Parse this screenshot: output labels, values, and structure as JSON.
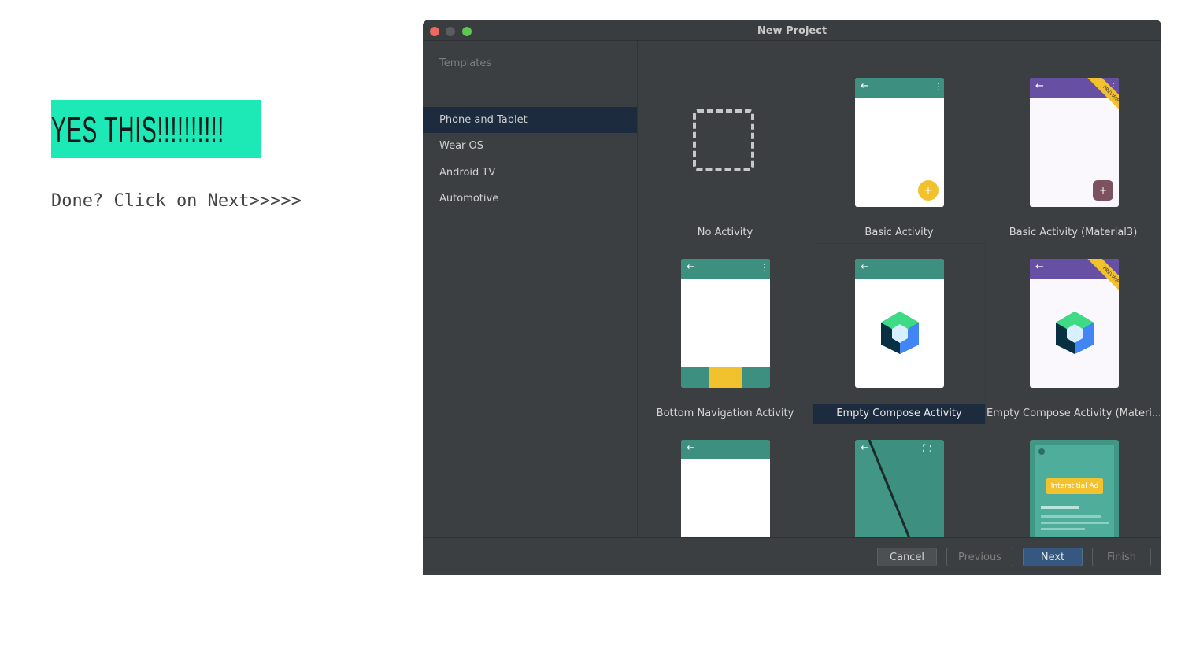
{
  "slide": {
    "banner_text": "YES THIS!!!!!!!!!!",
    "instruction": "Done? Click on Next>>>>>"
  },
  "dialog": {
    "title": "New Project",
    "sidebar": {
      "heading": "Templates",
      "items": [
        {
          "label": "Phone and Tablet",
          "selected": true
        },
        {
          "label": "Wear OS",
          "selected": false
        },
        {
          "label": "Android TV",
          "selected": false
        },
        {
          "label": "Automotive",
          "selected": false
        }
      ]
    },
    "templates": [
      {
        "label": "No Activity"
      },
      {
        "label": "Basic Activity"
      },
      {
        "label": "Basic Activity (Material3)",
        "badge": "PREVIEW"
      },
      {
        "label": "Bottom Navigation Activity"
      },
      {
        "label": "Empty Compose Activity",
        "selected": true
      },
      {
        "label": "Empty Compose Activity (Materi...",
        "badge": "PREVIEW"
      },
      {
        "label": ""
      },
      {
        "label": ""
      },
      {
        "label": "",
        "inner_text": "Interstitial Ad"
      }
    ],
    "buttons": {
      "cancel": "Cancel",
      "previous": "Previous",
      "next": "Next",
      "finish": "Finish"
    },
    "colors": {
      "teal": "#3d8f7f",
      "purple": "#6750a4",
      "fab_yellow": "#f2c12e",
      "selection": "#1c2b3e",
      "primary_button": "#365880"
    }
  }
}
